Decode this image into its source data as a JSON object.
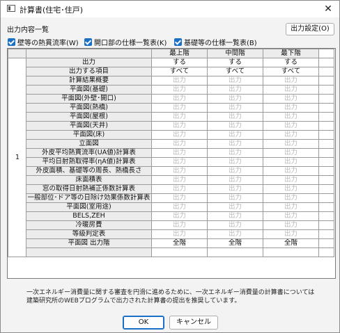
{
  "window": {
    "title": "計算書(住宅･住戸)",
    "close_glyph": "✕"
  },
  "section_label": "出力内容一覧",
  "output_settings_label": "出力設定(O)",
  "checkboxes": [
    {
      "label": "壁等の熱貫流率(W)"
    },
    {
      "label": "開口部の仕様一覧表(K)"
    },
    {
      "label": "基礎等の仕様一覧表(B)"
    }
  ],
  "table": {
    "index": "1",
    "columns": [
      "最上階",
      "中間階",
      "最下階"
    ],
    "rows": [
      {
        "label": "出力",
        "values": [
          "する",
          "する",
          "する"
        ],
        "dim": false
      },
      {
        "label": "出力する項目",
        "values": [
          "すべて",
          "すべて",
          "すべて"
        ],
        "dim": false
      },
      {
        "label": "計算結果概要",
        "values": [
          "出力",
          "出力",
          "出力"
        ],
        "dim": true
      },
      {
        "label": "平面図(基礎)",
        "values": [
          "出力",
          "出力",
          "出力"
        ],
        "dim": true
      },
      {
        "label": "平面図(外壁･開口)",
        "values": [
          "出力",
          "出力",
          "出力"
        ],
        "dim": true
      },
      {
        "label": "平面図(熱橋)",
        "values": [
          "出力",
          "出力",
          "出力"
        ],
        "dim": true
      },
      {
        "label": "平面図(屋根)",
        "values": [
          "出力",
          "出力",
          "出力"
        ],
        "dim": true
      },
      {
        "label": "平面図(天井)",
        "values": [
          "出力",
          "出力",
          "出力"
        ],
        "dim": true
      },
      {
        "label": "平面図(床)",
        "values": [
          "出力",
          "出力",
          "出力"
        ],
        "dim": true
      },
      {
        "label": "立面図",
        "values": [
          "出力",
          "出力",
          "出力"
        ],
        "dim": true
      },
      {
        "label": "外皮平均熱貫流率(UA値)計算表",
        "values": [
          "出力",
          "出力",
          "出力"
        ],
        "dim": true
      },
      {
        "label": "平均日射熱取得率(ηA値)計算表",
        "values": [
          "出力",
          "出力",
          "出力"
        ],
        "dim": true
      },
      {
        "label": "外皮面積、基礎等の周長、熱橋長さ",
        "values": [
          "出力",
          "出力",
          "出力"
        ],
        "dim": true
      },
      {
        "label": "床面積表",
        "values": [
          "出力",
          "出力",
          "出力"
        ],
        "dim": true
      },
      {
        "label": "窓の取得日射熱補正係数計算表",
        "values": [
          "出力",
          "出力",
          "出力"
        ],
        "dim": true
      },
      {
        "label": "一般部位･ドア等の日除け効果係数計算表",
        "values": [
          "出力",
          "出力",
          "出力"
        ],
        "dim": true
      },
      {
        "label": "平面図(室用途)",
        "values": [
          "出力",
          "出力",
          "出力"
        ],
        "dim": true
      },
      {
        "label": "BELS,ZEH",
        "values": [
          "出力",
          "出力",
          "出力"
        ],
        "dim": true
      },
      {
        "label": "冷暖房費",
        "values": [
          "出力",
          "出力",
          "出力"
        ],
        "dim": true
      },
      {
        "label": "等級判定表",
        "values": [
          "出力",
          "出力",
          "出力"
        ],
        "dim": true
      },
      {
        "label": "平面図 出力階",
        "values": [
          "全階",
          "全階",
          "全階"
        ],
        "dim": false
      }
    ]
  },
  "note": {
    "line1": "一次エネルギー消費量に関する審査を円滑に進めるために、一次エネルギー消費量の計算書については",
    "line2": "建築研究所のWEBプログラムで出力された計算書の提出を推奨しています。"
  },
  "buttons": {
    "ok": "OK",
    "cancel": "キャンセル"
  }
}
